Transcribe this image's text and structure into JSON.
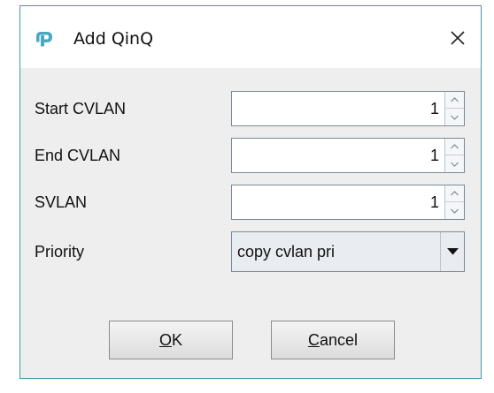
{
  "dialog": {
    "title": "Add QinQ",
    "icons": {
      "app": "tp-link-logo-icon",
      "close": "close-icon"
    },
    "accent_color": "#3c9aa6"
  },
  "form": {
    "start_cvlan": {
      "label": "Start CVLAN",
      "value": "1"
    },
    "end_cvlan": {
      "label": "End CVLAN",
      "value": "1"
    },
    "svlan": {
      "label": "SVLAN",
      "value": "1"
    },
    "priority": {
      "label": "Priority",
      "value": "copy cvlan pri"
    }
  },
  "buttons": {
    "ok": {
      "mnemonic": "O",
      "rest": "K"
    },
    "cancel": {
      "mnemonic": "C",
      "rest": "ancel"
    }
  }
}
